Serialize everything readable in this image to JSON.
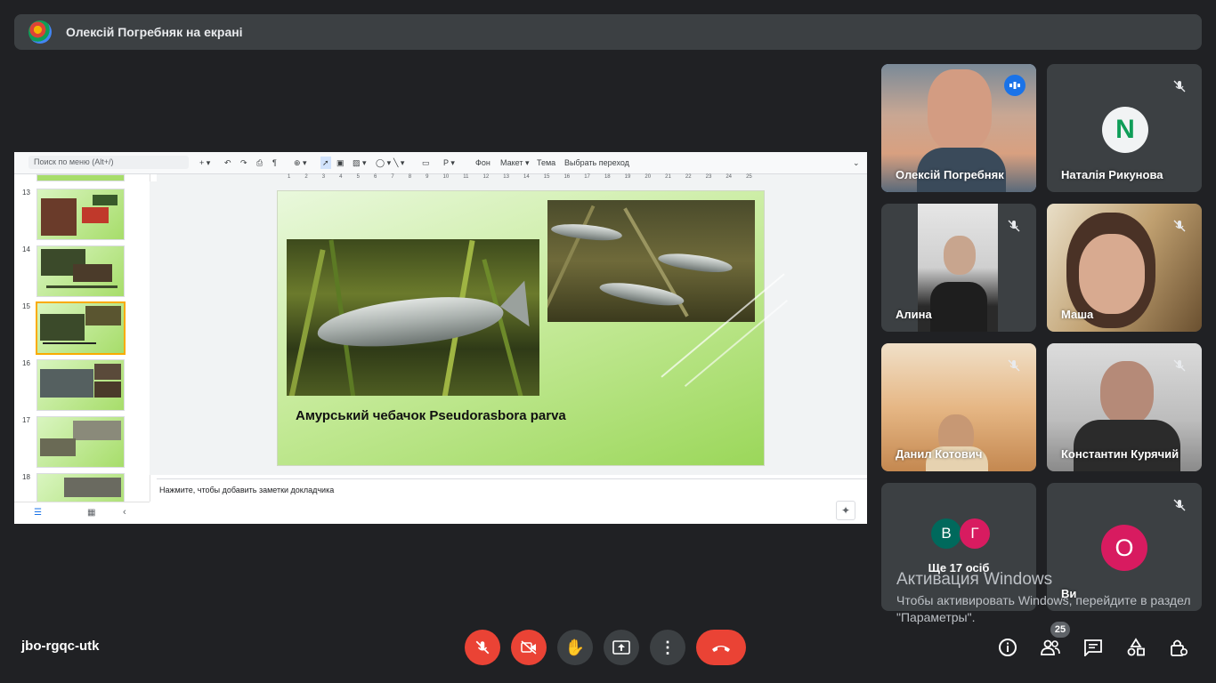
{
  "banner": {
    "presenter_text": "Олексій Погребняк на екрані"
  },
  "slides_app": {
    "menu_search_placeholder": "Поиск по меню (Alt+/)",
    "toolbar": {
      "background": "Фон",
      "layout": "Макет",
      "theme": "Тема",
      "transition": "Выбрать переход"
    },
    "ruler_ticks": [
      "1",
      "2",
      "3",
      "4",
      "5",
      "6",
      "7",
      "8",
      "9",
      "10",
      "11",
      "12",
      "13",
      "14",
      "15",
      "16",
      "17",
      "18",
      "19",
      "20",
      "21",
      "22",
      "23",
      "24",
      "25"
    ],
    "thumbnails": [
      {
        "number": "13",
        "caption": ""
      },
      {
        "number": "14",
        "caption": ""
      },
      {
        "number": "15",
        "caption": "",
        "selected": true
      },
      {
        "number": "16",
        "caption": ""
      },
      {
        "number": "17",
        "caption": ""
      },
      {
        "number": "18",
        "caption": ""
      }
    ],
    "slide_caption": "Амурський чебачок Pseudorasbora parva",
    "speaker_notes_placeholder": "Нажмите, чтобы добавить заметки докладчика"
  },
  "participants": [
    {
      "name": "Олексій Погребняк",
      "speaking": true
    },
    {
      "name": "Наталія Рикунова",
      "avatar_letter": "N",
      "muted": true
    },
    {
      "name": "Алина",
      "muted": true
    },
    {
      "name": "Маша",
      "muted": true
    },
    {
      "name": "Данил Котович",
      "muted": true
    },
    {
      "name": "Константин Курячий",
      "muted": true
    },
    {
      "name": "Ще 17 осіб",
      "avatars": [
        "В",
        "Г"
      ]
    },
    {
      "name": "Ви",
      "avatar_letter": "О",
      "muted": true
    }
  ],
  "windows_activation": {
    "title": "Активация Windows",
    "text": "Чтобы активировать Windows, перейдите в раздел \"Параметры\"."
  },
  "bottom_bar": {
    "meeting_code": "jbo-rgqc-utk",
    "participants_count": "25"
  },
  "colors": {
    "background": "#202124",
    "tile": "#3c4043",
    "danger": "#ea4335",
    "accent": "#8ab4f8"
  }
}
